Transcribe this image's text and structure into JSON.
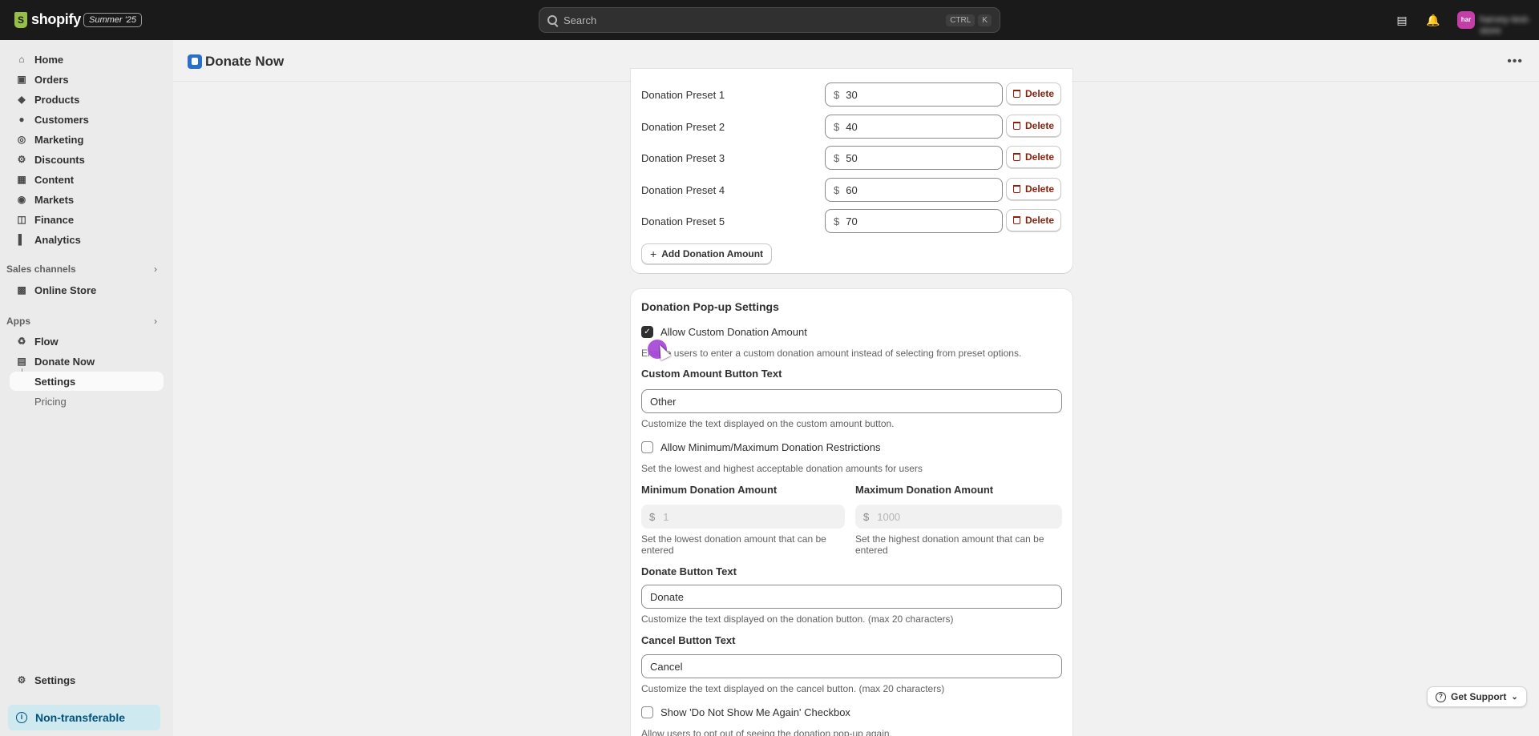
{
  "topbar": {
    "logo_text": "shopify",
    "edition": "Summer '25",
    "search_placeholder": "Search",
    "shortcut_key1": "CTRL",
    "shortcut_key2": "K",
    "avatar_initials": "har",
    "store_name": "harvey-test-store"
  },
  "sidebar": {
    "items": [
      {
        "label": "Home",
        "icon": "home-icon"
      },
      {
        "label": "Orders",
        "icon": "orders-icon"
      },
      {
        "label": "Products",
        "icon": "products-icon"
      },
      {
        "label": "Customers",
        "icon": "customers-icon"
      },
      {
        "label": "Marketing",
        "icon": "marketing-icon"
      },
      {
        "label": "Discounts",
        "icon": "discounts-icon"
      },
      {
        "label": "Content",
        "icon": "content-icon"
      },
      {
        "label": "Markets",
        "icon": "markets-icon"
      },
      {
        "label": "Finance",
        "icon": "finance-icon"
      },
      {
        "label": "Analytics",
        "icon": "analytics-icon"
      }
    ],
    "sales_channels_label": "Sales channels",
    "online_store": "Online Store",
    "apps_label": "Apps",
    "flow": "Flow",
    "donate_now": "Donate Now",
    "settings_sub": "Settings",
    "pricing_sub": "Pricing",
    "settings": "Settings",
    "non_transferable": "Non-transferable"
  },
  "header": {
    "title": "Donate Now"
  },
  "presets": {
    "currency": "$",
    "delete_label": "Delete",
    "add_label": "Add Donation Amount",
    "rows": [
      {
        "label": "Donation Preset 1",
        "value": "30"
      },
      {
        "label": "Donation Preset 2",
        "value": "40"
      },
      {
        "label": "Donation Preset 3",
        "value": "50"
      },
      {
        "label": "Donation Preset 4",
        "value": "60"
      },
      {
        "label": "Donation Preset 5",
        "value": "70"
      }
    ]
  },
  "popup": {
    "title": "Donation Pop-up Settings",
    "allow_custom_label": "Allow Custom Donation Amount",
    "allow_custom_checked": true,
    "allow_custom_help": "Enable users to enter a custom donation amount instead of selecting from preset options.",
    "custom_button_label": "Custom Amount Button Text",
    "custom_button_value": "Other",
    "custom_button_help": "Customize the text displayed on the custom amount button.",
    "minmax_label": "Allow Minimum/Maximum Donation Restrictions",
    "minmax_checked": false,
    "minmax_help": "Set the lowest and highest acceptable donation amounts for users",
    "min_label": "Minimum Donation Amount",
    "min_value": "1",
    "min_help": "Set the lowest donation amount that can be entered",
    "max_label": "Maximum Donation Amount",
    "max_value": "1000",
    "max_help": "Set the highest donation amount that can be entered",
    "donate_label": "Donate Button Text",
    "donate_value": "Donate",
    "donate_help": "Customize the text displayed on the donation button. (max 20 characters)",
    "cancel_label": "Cancel Button Text",
    "cancel_value": "Cancel",
    "cancel_help": "Customize the text displayed on the cancel button. (max 20 characters)",
    "dont_show_label": "Show 'Do Not Show Me Again' Checkbox",
    "dont_show_checked": false,
    "dont_show_help": "Allow users to opt out of seeing the donation pop-up again."
  },
  "support": {
    "label": "Get Support"
  }
}
